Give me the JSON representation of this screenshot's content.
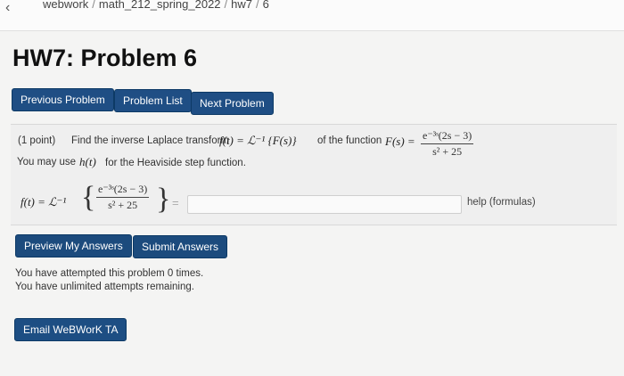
{
  "header": {
    "back_glyph": "‹",
    "crumbs": [
      "webwork",
      "math_212_spring_2022",
      "hw7",
      "6"
    ]
  },
  "page_title": "HW7: Problem 6",
  "nav": {
    "previous": "Previous Problem",
    "list": "Problem List",
    "next": "Next Problem"
  },
  "problem": {
    "points": "(1 point)",
    "statement": "Find the inverse Laplace transform",
    "ft_expr": "f(t) = ℒ⁻¹ {F(s)}",
    "of_function": "of the function",
    "Fs_lhs": "F(s) =",
    "frac_num": "e⁻³ˢ(2s − 3)",
    "frac_den": "s² + 25",
    "heaviside_pre": "You may use",
    "heaviside_sym": "h(t)",
    "heaviside_post": "for the Heaviside step function.",
    "answer_lhs": "f(t) = ℒ⁻¹",
    "brace_open": "{",
    "brace_close": "}",
    "equals": "=",
    "answer_value": "",
    "help": "help (formulas)"
  },
  "actions": {
    "preview": "Preview My Answers",
    "submit": "Submit Answers"
  },
  "status": {
    "attempted": "You have attempted this problem 0 times.",
    "remaining": "You have unlimited attempts remaining."
  },
  "email": "Email WeBWorK TA",
  "colors": {
    "button": "#1f4e84",
    "page_bg": "#f4f4f3",
    "problem_bg": "#efefef"
  }
}
